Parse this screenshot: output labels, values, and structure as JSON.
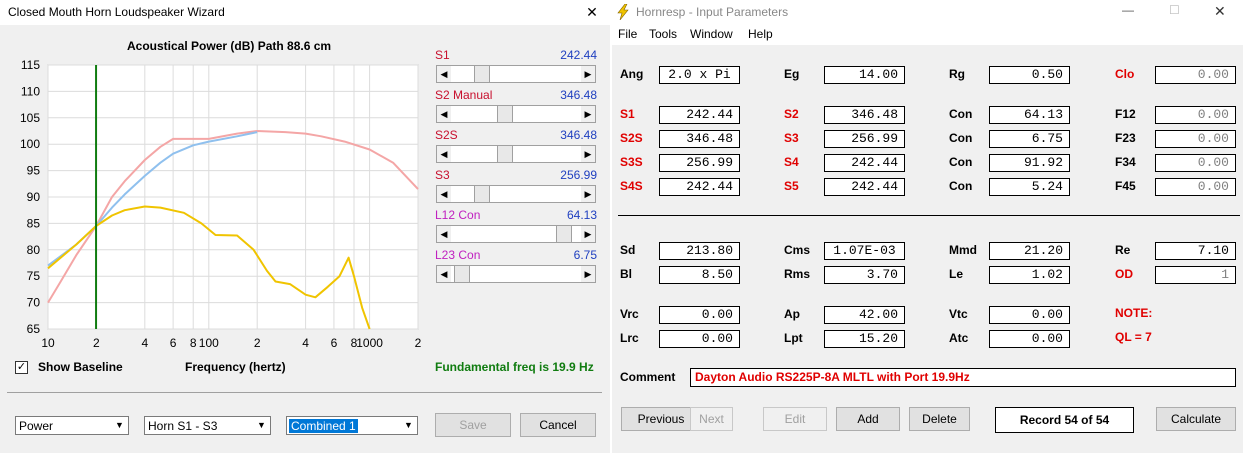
{
  "wizard": {
    "title": "Closed Mouth Horn Loudspeaker Wizard",
    "close_glyph": "✕",
    "chart_caption": "Acoustical Power (dB)   Path 88.6 cm",
    "show_baseline_label": "Show Baseline",
    "show_baseline_checked": true,
    "freq_axis_label": "Frequency (hertz)",
    "fundamental_text": "Fundamental freq is 19.9 Hz",
    "sliders": [
      {
        "label": "S1",
        "value": "242.44",
        "label_color": "#c8102e",
        "position": 0.2
      },
      {
        "label": "S2  Manual",
        "value": "346.48",
        "label_color": "#c8102e",
        "position": 0.4
      },
      {
        "label": "S2S",
        "value": "346.48",
        "label_color": "#c8102e",
        "position": 0.4
      },
      {
        "label": "S3",
        "value": "256.99",
        "label_color": "#c8102e",
        "position": 0.2
      },
      {
        "label": "L12  Con",
        "value": "64.13",
        "label_color": "#c020c0",
        "position": 0.92
      },
      {
        "label": "L23  Con",
        "value": "6.75",
        "label_color": "#c020c0",
        "position": 0.03
      }
    ],
    "combo_type": "Power",
    "combo_horn": "Horn S1 - S3",
    "combo_mode": "Combined 1",
    "save_label": "Save",
    "cancel_label": "Cancel"
  },
  "chart_data": {
    "type": "line",
    "xscale": "log",
    "xlim": [
      10,
      2000
    ],
    "ylim": [
      65,
      115
    ],
    "yticks": [
      65,
      70,
      75,
      80,
      85,
      90,
      95,
      100,
      105,
      110,
      115
    ],
    "xtick_labels": [
      {
        "x": 10,
        "label": "10"
      },
      {
        "x": 20,
        "label": "2"
      },
      {
        "x": 40,
        "label": "4"
      },
      {
        "x": 60,
        "label": "6"
      },
      {
        "x": 80,
        "label": "8"
      },
      {
        "x": 100,
        "label": "100"
      },
      {
        "x": 200,
        "label": "2"
      },
      {
        "x": 400,
        "label": "4"
      },
      {
        "x": 600,
        "label": "6"
      },
      {
        "x": 800,
        "label": "8"
      },
      {
        "x": 1000,
        "label": "1000"
      },
      {
        "x": 2000,
        "label": "2"
      }
    ],
    "marker_x": 19.9,
    "series": [
      {
        "color": "#f4a6a6",
        "points": [
          [
            10,
            70
          ],
          [
            12,
            74
          ],
          [
            15,
            79
          ],
          [
            19.9,
            84.5
          ],
          [
            25,
            90
          ],
          [
            30,
            93
          ],
          [
            40,
            97
          ],
          [
            50,
            99.5
          ],
          [
            60,
            101
          ],
          [
            80,
            101
          ],
          [
            100,
            101
          ],
          [
            150,
            102
          ],
          [
            200,
            102.5
          ],
          [
            300,
            102.3
          ],
          [
            400,
            102
          ],
          [
            500,
            101.5
          ],
          [
            700,
            100.5
          ],
          [
            1000,
            99
          ],
          [
            1400,
            96.5
          ],
          [
            2000,
            91.5
          ]
        ]
      },
      {
        "color": "#8fc0ee",
        "points": [
          [
            10,
            77
          ],
          [
            15,
            81
          ],
          [
            19.9,
            84.5
          ],
          [
            25,
            88
          ],
          [
            30,
            90.5
          ],
          [
            40,
            94
          ],
          [
            50,
            96.5
          ],
          [
            60,
            98.2
          ],
          [
            80,
            99.8
          ],
          [
            100,
            100.5
          ],
          [
            150,
            101.5
          ],
          [
            200,
            102.3
          ]
        ]
      },
      {
        "color": "#f0c400",
        "points": [
          [
            10,
            76.5
          ],
          [
            15,
            81
          ],
          [
            19.9,
            84.5
          ],
          [
            25,
            86.5
          ],
          [
            30,
            87.5
          ],
          [
            40,
            88.2
          ],
          [
            50,
            88
          ],
          [
            70,
            87
          ],
          [
            90,
            85
          ],
          [
            110,
            82.8
          ],
          [
            150,
            82.7
          ],
          [
            190,
            80
          ],
          [
            230,
            76
          ],
          [
            260,
            74
          ],
          [
            320,
            73.5
          ],
          [
            400,
            71.5
          ],
          [
            460,
            71
          ],
          [
            550,
            73
          ],
          [
            650,
            75
          ],
          [
            740,
            78.5
          ],
          [
            800,
            75
          ],
          [
            900,
            69
          ],
          [
            1000,
            65
          ]
        ]
      }
    ]
  },
  "hornresp": {
    "title": "Hornresp - Input Parameters",
    "window_controls": [
      "—",
      "☐",
      "✕"
    ],
    "menu": [
      "File",
      "Tools",
      "Window",
      "Help"
    ],
    "fields": {
      "ang": {
        "label": "Ang",
        "value": "2.0 x Pi"
      },
      "eg": {
        "label": "Eg",
        "value": "14.00"
      },
      "rg": {
        "label": "Rg",
        "value": "0.50"
      },
      "clo": {
        "label": "Clo",
        "value": "0.00"
      },
      "s1": {
        "label": "S1",
        "value": "242.44"
      },
      "s2": {
        "label": "S2",
        "value": "346.48"
      },
      "con1": {
        "label": "Con",
        "value": "64.13"
      },
      "f12": {
        "label": "F12",
        "value": "0.00"
      },
      "s2s": {
        "label": "S2S",
        "value": "346.48"
      },
      "s3": {
        "label": "S3",
        "value": "256.99"
      },
      "con2": {
        "label": "Con",
        "value": "6.75"
      },
      "f23": {
        "label": "F23",
        "value": "0.00"
      },
      "s3s": {
        "label": "S3S",
        "value": "256.99"
      },
      "s4": {
        "label": "S4",
        "value": "242.44"
      },
      "con3": {
        "label": "Con",
        "value": "91.92"
      },
      "f34": {
        "label": "F34",
        "value": "0.00"
      },
      "s4s": {
        "label": "S4S",
        "value": "242.44"
      },
      "s5": {
        "label": "S5",
        "value": "242.44"
      },
      "con4": {
        "label": "Con",
        "value": "5.24"
      },
      "f45": {
        "label": "F45",
        "value": "0.00"
      },
      "sd": {
        "label": "Sd",
        "value": "213.80"
      },
      "cms": {
        "label": "Cms",
        "value": "1.07E-03"
      },
      "mmd": {
        "label": "Mmd",
        "value": "21.20"
      },
      "re": {
        "label": "Re",
        "value": "7.10"
      },
      "bl": {
        "label": "Bl",
        "value": "8.50"
      },
      "rms": {
        "label": "Rms",
        "value": "3.70"
      },
      "le": {
        "label": "Le",
        "value": "1.02"
      },
      "od": {
        "label": "OD",
        "value": "1"
      },
      "vrc": {
        "label": "Vrc",
        "value": "0.00"
      },
      "ap": {
        "label": "Ap",
        "value": "42.00"
      },
      "vtc": {
        "label": "Vtc",
        "value": "0.00"
      },
      "lrc": {
        "label": "Lrc",
        "value": "0.00"
      },
      "lpt": {
        "label": "Lpt",
        "value": "15.20"
      },
      "atc": {
        "label": "Atc",
        "value": "0.00"
      }
    },
    "note_label": "NOTE:",
    "note_ql": "QL = 7",
    "comment_label": "Comment",
    "comment_value": "Dayton Audio RS225P-8A MLTL with Port 19.9Hz",
    "buttons": {
      "previous": "Previous",
      "next": "Next",
      "edit": "Edit",
      "add": "Add",
      "delete": "Delete",
      "record": "Record 54 of 54",
      "calculate": "Calculate"
    },
    "colors": {
      "red_label": "#e00000",
      "gray_value": "#808080"
    }
  }
}
